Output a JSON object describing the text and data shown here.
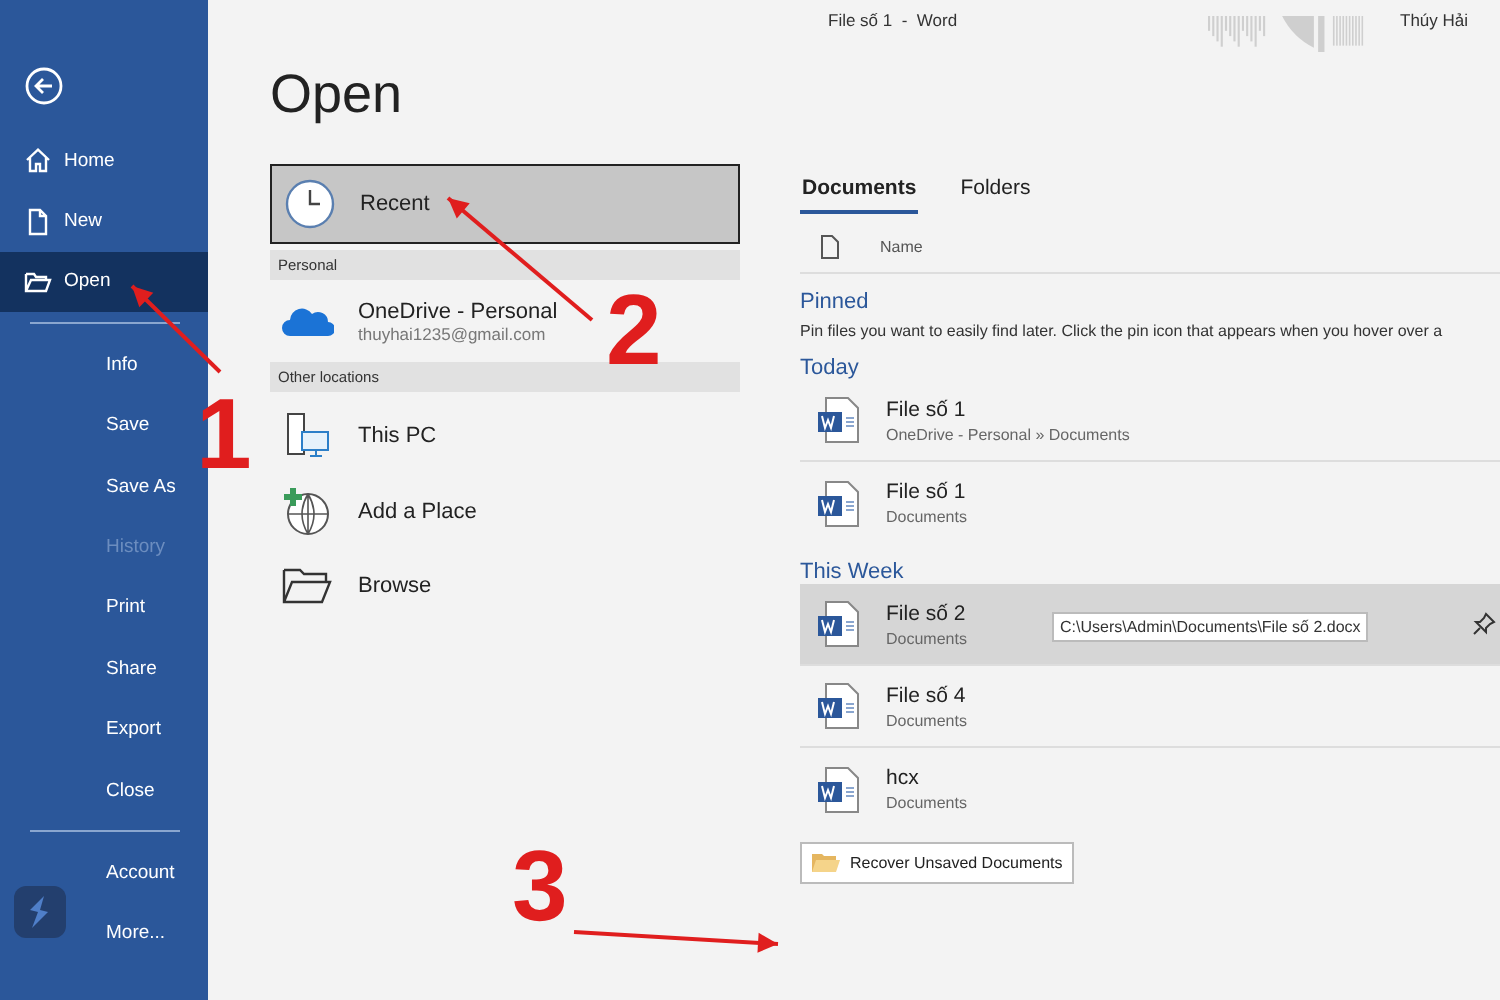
{
  "window": {
    "title": "File số 1  -  Word",
    "user": "Thúy Hải"
  },
  "sidebar": {
    "groups": [
      [
        {
          "label": "Home",
          "kind": "home",
          "selected": false,
          "disabled": false
        },
        {
          "label": "New",
          "kind": "new",
          "selected": false,
          "disabled": false
        },
        {
          "label": "Open",
          "kind": "open",
          "selected": true,
          "disabled": false
        }
      ],
      [
        {
          "label": "Info",
          "kind": "plain",
          "selected": false,
          "disabled": false
        },
        {
          "label": "Save",
          "kind": "plain",
          "selected": false,
          "disabled": false
        },
        {
          "label": "Save As",
          "kind": "plain",
          "selected": false,
          "disabled": false
        },
        {
          "label": "History",
          "kind": "plain",
          "selected": false,
          "disabled": true
        },
        {
          "label": "Print",
          "kind": "plain",
          "selected": false,
          "disabled": false
        },
        {
          "label": "Share",
          "kind": "plain",
          "selected": false,
          "disabled": false
        },
        {
          "label": "Export",
          "kind": "plain",
          "selected": false,
          "disabled": false
        },
        {
          "label": "Close",
          "kind": "plain",
          "selected": false,
          "disabled": false
        }
      ],
      [
        {
          "label": "Account",
          "kind": "plain",
          "selected": false,
          "disabled": false
        },
        {
          "label": "More...",
          "kind": "plain",
          "selected": false,
          "disabled": false
        }
      ]
    ]
  },
  "page_title": "Open",
  "locations": [
    {
      "kind": "recent",
      "label": "Recent",
      "selected": true
    },
    {
      "kind": "header",
      "label": "Personal"
    },
    {
      "kind": "onedrive",
      "label": "OneDrive - Personal",
      "sublabel": "thuyhai1235@gmail.com",
      "selected": false
    },
    {
      "kind": "header",
      "label": "Other locations"
    },
    {
      "kind": "pc",
      "label": "This PC",
      "selected": false
    },
    {
      "kind": "add",
      "label": "Add a Place",
      "selected": false
    },
    {
      "kind": "browse",
      "label": "Browse",
      "selected": false
    }
  ],
  "tabs": [
    {
      "label": "Documents",
      "selected": true
    },
    {
      "label": "Folders",
      "selected": false
    }
  ],
  "column": "Name",
  "sections": [
    {
      "title": "Pinned",
      "description": "Pin files you want to easily find later. Click the pin icon that appears when you hover over a"
    },
    {
      "title": "Today",
      "files": [
        {
          "name": "File số 1",
          "location": "OneDrive - Personal » Documents",
          "selected": false
        },
        {
          "name": "File số 1",
          "location": "Documents",
          "selected": false
        }
      ]
    },
    {
      "title": "This Week",
      "files": [
        {
          "name": "File số 2",
          "location": "Documents",
          "selected": true,
          "tooltip": "C:\\Users\\Admin\\Documents\\File số 2.docx"
        },
        {
          "name": "File số 4",
          "location": "Documents",
          "selected": false
        },
        {
          "name": "hcx",
          "location": "Documents",
          "selected": false
        }
      ]
    }
  ],
  "recover_button": "Recover Unsaved Documents",
  "annotations": [
    {
      "label": "1"
    },
    {
      "label": "2"
    },
    {
      "label": "3"
    }
  ]
}
